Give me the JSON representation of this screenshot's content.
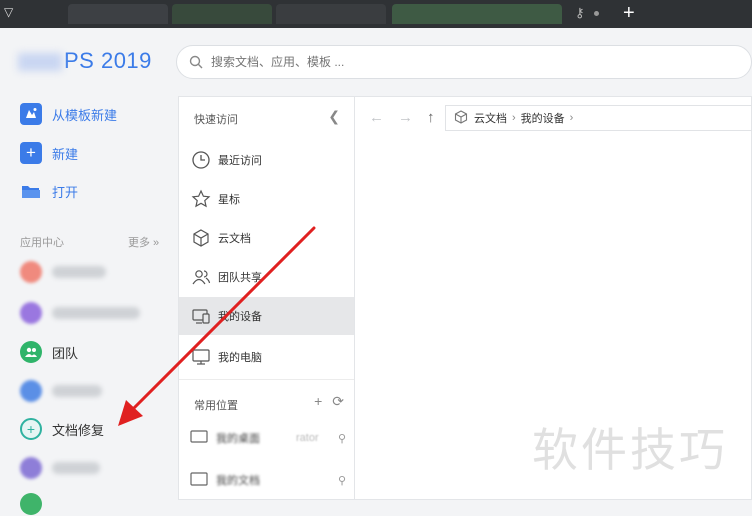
{
  "titlebar": {
    "text": "▽",
    "new_tab": "+",
    "key": "⚷"
  },
  "app": {
    "logo_visible_text": "PS 2019"
  },
  "sidebar": {
    "actions": [
      {
        "label": "从模板新建",
        "icon": "template-icon"
      },
      {
        "label": "新建",
        "icon": "plus-icon"
      },
      {
        "label": "打开",
        "icon": "folder-icon"
      }
    ],
    "section_label": "应用中心",
    "more_label": "更多 »",
    "apps": [
      {
        "label": "团队",
        "icon": "team-icon"
      },
      {
        "label": "文档修复",
        "icon": "doc-repair-icon"
      }
    ]
  },
  "search": {
    "placeholder": "搜索文档、应用、模板 ..."
  },
  "nav": {
    "quick_access_label": "快速访问",
    "items": [
      {
        "label": "最近访问",
        "icon": "clock-icon"
      },
      {
        "label": "星标",
        "icon": "star-icon"
      },
      {
        "label": "云文档",
        "icon": "cloud-doc-icon"
      },
      {
        "label": "团队共享",
        "icon": "team-share-icon"
      },
      {
        "label": "我的设备",
        "icon": "device-icon"
      },
      {
        "label": "我的电脑",
        "icon": "computer-icon"
      }
    ],
    "active_index": 4,
    "common_locations_label": "常用位置",
    "locations": [
      {
        "label": "我的桌面"
      },
      {
        "label": "我的文档"
      }
    ],
    "location_hint": "rator"
  },
  "main": {
    "breadcrumb": [
      "云文档",
      "我的设备"
    ]
  },
  "watermark": "软件技巧",
  "colors": {
    "accent": "#3b7be8",
    "arrow": "#e02020",
    "team_icon": "#2fb46a",
    "repair_icon": "#2fb2a0"
  }
}
